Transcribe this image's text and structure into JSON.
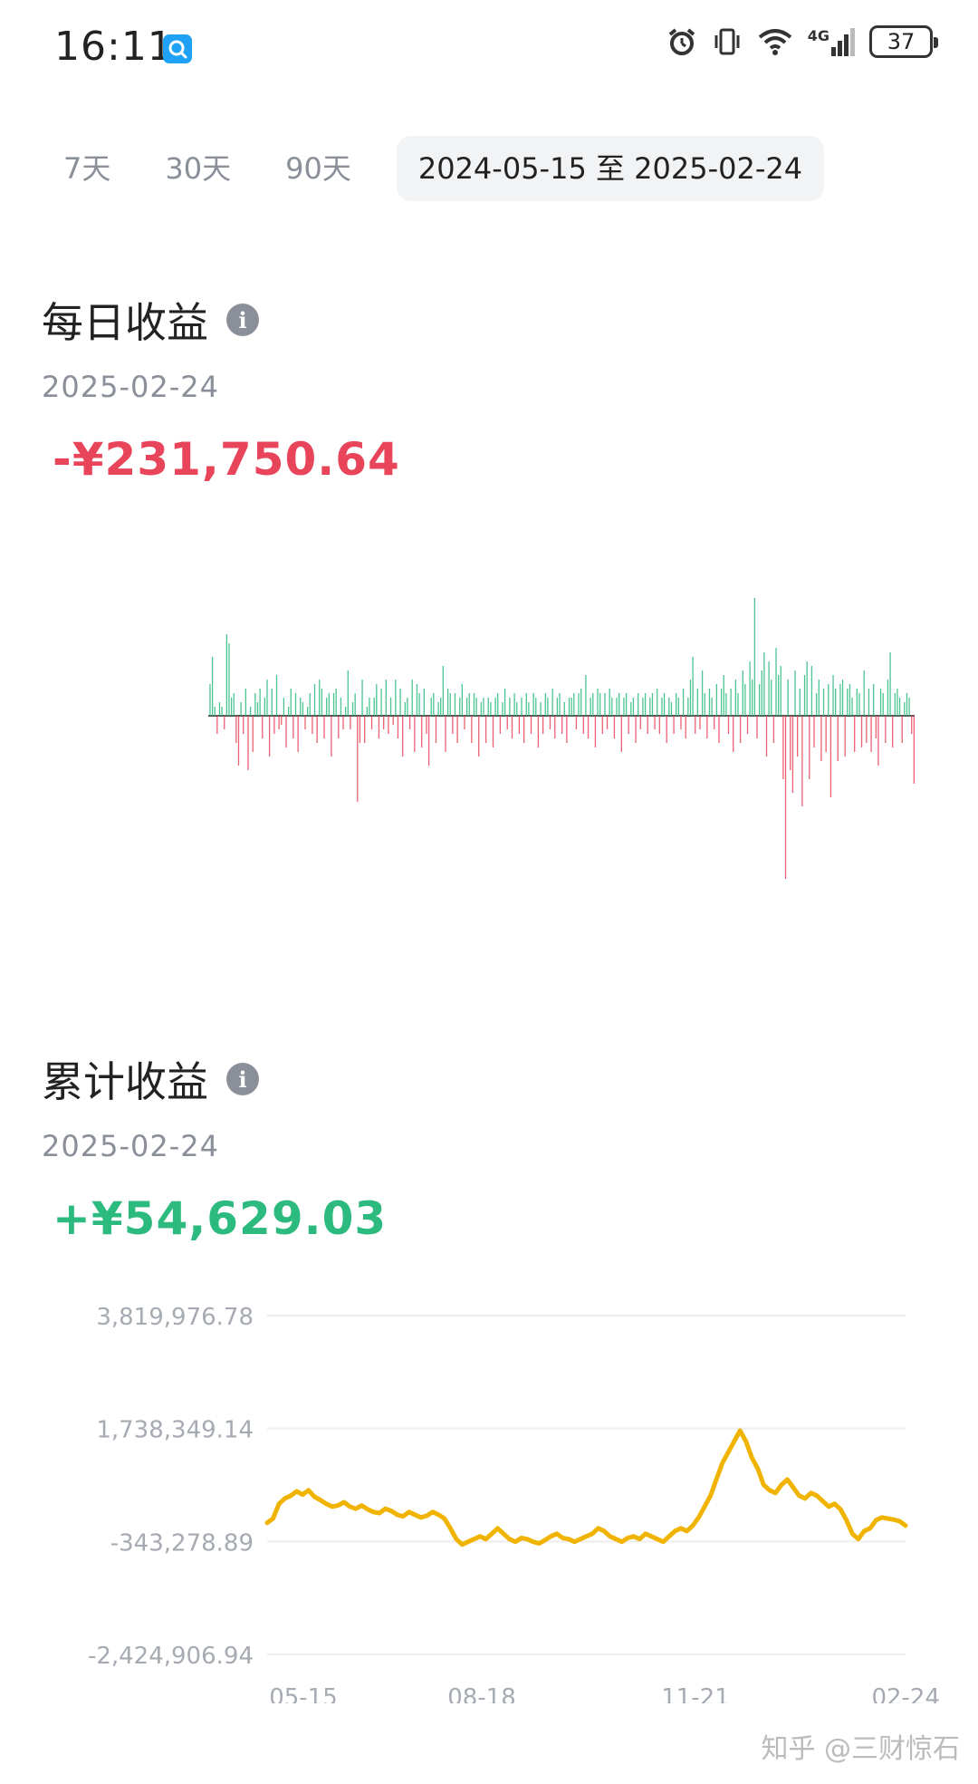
{
  "status_bar": {
    "time": "16:11",
    "app_icon": "search-icon",
    "network": "4G",
    "battery": "37"
  },
  "range_tabs": [
    {
      "label": "7天",
      "selected": false
    },
    {
      "label": "30天",
      "selected": false
    },
    {
      "label": "90天",
      "selected": false
    },
    {
      "label": "2024-05-15 至 2025-02-24",
      "selected": true
    }
  ],
  "daily": {
    "title": "每日收益",
    "date": "2025-02-24",
    "value": "-¥231,750.64"
  },
  "cumulative": {
    "title": "累计收益",
    "date": "2025-02-24",
    "value": "+¥54,629.03"
  },
  "watermark": "知乎 @三财惊石",
  "colors": {
    "gain": "#2dba7f",
    "loss": "#e8455a",
    "cumulative_line": "#f0b400",
    "muted_text": "#8a8f99"
  },
  "chart_data": [
    {
      "type": "bar",
      "x_range": [
        "2024-05-15",
        "2025-02-24"
      ],
      "values": [
        35,
        65,
        10,
        -20,
        15,
        10,
        -15,
        90,
        80,
        20,
        25,
        -30,
        -55,
        15,
        -20,
        30,
        -60,
        10,
        -40,
        25,
        15,
        30,
        -25,
        20,
        40,
        -45,
        30,
        -20,
        45,
        -15,
        -10,
        20,
        -35,
        10,
        30,
        -25,
        25,
        -40,
        20,
        15,
        -15,
        10,
        25,
        -20,
        35,
        -30,
        40,
        30,
        -25,
        20,
        25,
        -45,
        25,
        30,
        -25,
        20,
        -15,
        10,
        50,
        -15,
        15,
        25,
        -95,
        -30,
        40,
        -30,
        10,
        20,
        -15,
        20,
        35,
        -25,
        30,
        -15,
        40,
        -20,
        20,
        -10,
        40,
        -25,
        30,
        -45,
        15,
        20,
        -15,
        40,
        -40,
        35,
        25,
        -35,
        30,
        -20,
        -55,
        20,
        25,
        -30,
        15,
        20,
        55,
        -40,
        30,
        25,
        -20,
        25,
        -30,
        20,
        35,
        -15,
        20,
        25,
        -30,
        25,
        20,
        -45,
        15,
        20,
        -30,
        20,
        15,
        -35,
        20,
        25,
        -20,
        15,
        30,
        -15,
        20,
        -25,
        25,
        15,
        -20,
        20,
        -30,
        25,
        15,
        -20,
        25,
        20,
        -35,
        15,
        -20,
        25,
        20,
        -15,
        30,
        -25,
        20,
        25,
        -20,
        15,
        -30,
        20,
        20,
        25,
        -15,
        25,
        30,
        -20,
        45,
        -25,
        20,
        25,
        -35,
        30,
        25,
        -20,
        25,
        -15,
        30,
        20,
        -25,
        20,
        25,
        -40,
        20,
        25,
        -20,
        15,
        20,
        -30,
        25,
        -15,
        20,
        25,
        -20,
        20,
        25,
        -15,
        30,
        -20,
        20,
        25,
        -30,
        20,
        15,
        -20,
        25,
        20,
        -15,
        30,
        -25,
        20,
        40,
        65,
        -20,
        30,
        -15,
        50,
        25,
        -25,
        30,
        20,
        -15,
        35,
        -30,
        30,
        45,
        25,
        -20,
        30,
        -40,
        40,
        25,
        -30,
        50,
        35,
        -20,
        60,
        40,
        130,
        -25,
        35,
        50,
        70,
        -45,
        60,
        40,
        -30,
        75,
        45,
        55,
        -70,
        -180,
        40,
        -60,
        -85,
        50,
        -45,
        30,
        -100,
        45,
        60,
        -70,
        55,
        -35,
        25,
        40,
        -50,
        30,
        -40,
        35,
        -90,
        45,
        30,
        -50,
        35,
        40,
        -45,
        30,
        35,
        20,
        -40,
        30,
        25,
        -35,
        50,
        -30,
        30,
        -40,
        35,
        -25,
        -55,
        30,
        25,
        -30,
        40,
        70,
        -35,
        25,
        30,
        20,
        -30,
        15,
        25,
        20,
        -20,
        -75
      ]
    },
    {
      "type": "line",
      "x_ticks": [
        "05-15",
        "08-18",
        "11-21",
        "02-24"
      ],
      "y_ticks": [
        "3,819,976.78",
        "1,738,349.14",
        "-343,278.89",
        "-2,424,906.94"
      ],
      "ylim": [
        -2424906.94,
        3819976.78
      ],
      "grid": true,
      "values": [
        0,
        80000,
        350000,
        450000,
        500000,
        580000,
        520000,
        600000,
        480000,
        420000,
        350000,
        300000,
        320000,
        380000,
        300000,
        260000,
        320000,
        250000,
        200000,
        180000,
        260000,
        220000,
        150000,
        120000,
        200000,
        150000,
        100000,
        130000,
        200000,
        150000,
        80000,
        -100000,
        -300000,
        -400000,
        -350000,
        -300000,
        -250000,
        -300000,
        -200000,
        -100000,
        -200000,
        -300000,
        -350000,
        -280000,
        -300000,
        -350000,
        -380000,
        -320000,
        -250000,
        -200000,
        -280000,
        -300000,
        -350000,
        -300000,
        -250000,
        -200000,
        -100000,
        -150000,
        -250000,
        -300000,
        -350000,
        -280000,
        -250000,
        -300000,
        -200000,
        -250000,
        -300000,
        -350000,
        -250000,
        -150000,
        -100000,
        -150000,
        -50000,
        100000,
        300000,
        500000,
        800000,
        1100000,
        1300000,
        1500000,
        1700000,
        1500000,
        1200000,
        1000000,
        700000,
        600000,
        550000,
        700000,
        800000,
        650000,
        500000,
        450000,
        550000,
        500000,
        400000,
        300000,
        350000,
        250000,
        50000,
        -200000,
        -300000,
        -150000,
        -100000,
        50000,
        100000,
        80000,
        60000,
        30000,
        -50000
      ]
    }
  ]
}
